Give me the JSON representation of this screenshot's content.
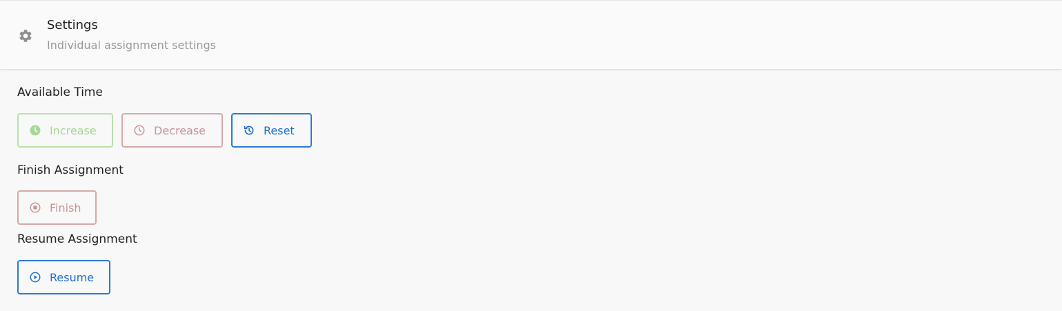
{
  "header": {
    "title": "Settings",
    "subtitle": "Individual assignment settings",
    "icon": "gear-icon"
  },
  "available_time": {
    "label": "Available Time",
    "increase_label": "Increase",
    "decrease_label": "Decrease",
    "reset_label": "Reset"
  },
  "finish_assignment": {
    "label": "Finish Assignment",
    "finish_label": "Finish"
  },
  "resume_assignment": {
    "label": "Resume Assignment",
    "resume_label": "Resume"
  },
  "colors": {
    "green": "#a6d796",
    "red": "#c89595",
    "blue": "#1e6fd0"
  }
}
